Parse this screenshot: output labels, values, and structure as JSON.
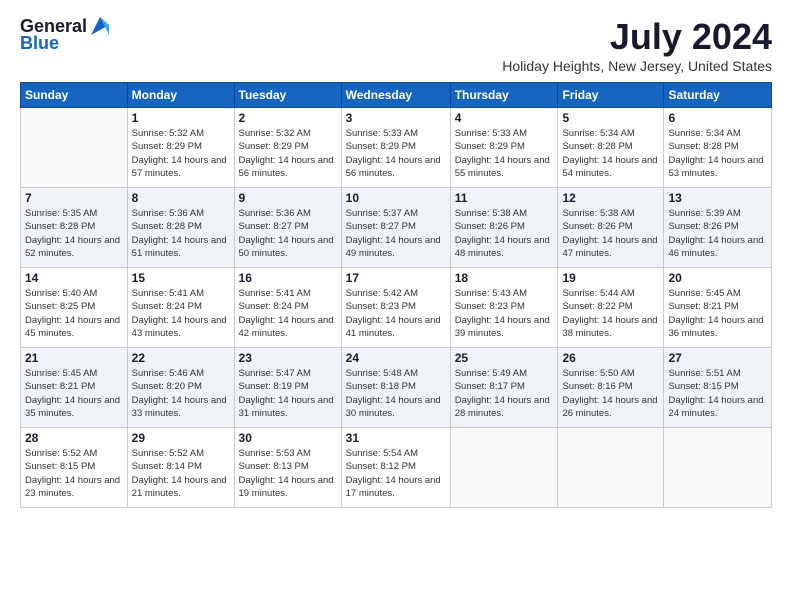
{
  "header": {
    "logo_line1": "General",
    "logo_line2": "Blue",
    "month": "July 2024",
    "location": "Holiday Heights, New Jersey, United States"
  },
  "days_of_week": [
    "Sunday",
    "Monday",
    "Tuesday",
    "Wednesday",
    "Thursday",
    "Friday",
    "Saturday"
  ],
  "weeks": [
    [
      {
        "day": "",
        "sunrise": "",
        "sunset": "",
        "daylight": ""
      },
      {
        "day": "1",
        "sunrise": "Sunrise: 5:32 AM",
        "sunset": "Sunset: 8:29 PM",
        "daylight": "Daylight: 14 hours and 57 minutes."
      },
      {
        "day": "2",
        "sunrise": "Sunrise: 5:32 AM",
        "sunset": "Sunset: 8:29 PM",
        "daylight": "Daylight: 14 hours and 56 minutes."
      },
      {
        "day": "3",
        "sunrise": "Sunrise: 5:33 AM",
        "sunset": "Sunset: 8:29 PM",
        "daylight": "Daylight: 14 hours and 56 minutes."
      },
      {
        "day": "4",
        "sunrise": "Sunrise: 5:33 AM",
        "sunset": "Sunset: 8:29 PM",
        "daylight": "Daylight: 14 hours and 55 minutes."
      },
      {
        "day": "5",
        "sunrise": "Sunrise: 5:34 AM",
        "sunset": "Sunset: 8:28 PM",
        "daylight": "Daylight: 14 hours and 54 minutes."
      },
      {
        "day": "6",
        "sunrise": "Sunrise: 5:34 AM",
        "sunset": "Sunset: 8:28 PM",
        "daylight": "Daylight: 14 hours and 53 minutes."
      }
    ],
    [
      {
        "day": "7",
        "sunrise": "Sunrise: 5:35 AM",
        "sunset": "Sunset: 8:28 PM",
        "daylight": "Daylight: 14 hours and 52 minutes."
      },
      {
        "day": "8",
        "sunrise": "Sunrise: 5:36 AM",
        "sunset": "Sunset: 8:28 PM",
        "daylight": "Daylight: 14 hours and 51 minutes."
      },
      {
        "day": "9",
        "sunrise": "Sunrise: 5:36 AM",
        "sunset": "Sunset: 8:27 PM",
        "daylight": "Daylight: 14 hours and 50 minutes."
      },
      {
        "day": "10",
        "sunrise": "Sunrise: 5:37 AM",
        "sunset": "Sunset: 8:27 PM",
        "daylight": "Daylight: 14 hours and 49 minutes."
      },
      {
        "day": "11",
        "sunrise": "Sunrise: 5:38 AM",
        "sunset": "Sunset: 8:26 PM",
        "daylight": "Daylight: 14 hours and 48 minutes."
      },
      {
        "day": "12",
        "sunrise": "Sunrise: 5:38 AM",
        "sunset": "Sunset: 8:26 PM",
        "daylight": "Daylight: 14 hours and 47 minutes."
      },
      {
        "day": "13",
        "sunrise": "Sunrise: 5:39 AM",
        "sunset": "Sunset: 8:26 PM",
        "daylight": "Daylight: 14 hours and 46 minutes."
      }
    ],
    [
      {
        "day": "14",
        "sunrise": "Sunrise: 5:40 AM",
        "sunset": "Sunset: 8:25 PM",
        "daylight": "Daylight: 14 hours and 45 minutes."
      },
      {
        "day": "15",
        "sunrise": "Sunrise: 5:41 AM",
        "sunset": "Sunset: 8:24 PM",
        "daylight": "Daylight: 14 hours and 43 minutes."
      },
      {
        "day": "16",
        "sunrise": "Sunrise: 5:41 AM",
        "sunset": "Sunset: 8:24 PM",
        "daylight": "Daylight: 14 hours and 42 minutes."
      },
      {
        "day": "17",
        "sunrise": "Sunrise: 5:42 AM",
        "sunset": "Sunset: 8:23 PM",
        "daylight": "Daylight: 14 hours and 41 minutes."
      },
      {
        "day": "18",
        "sunrise": "Sunrise: 5:43 AM",
        "sunset": "Sunset: 8:23 PM",
        "daylight": "Daylight: 14 hours and 39 minutes."
      },
      {
        "day": "19",
        "sunrise": "Sunrise: 5:44 AM",
        "sunset": "Sunset: 8:22 PM",
        "daylight": "Daylight: 14 hours and 38 minutes."
      },
      {
        "day": "20",
        "sunrise": "Sunrise: 5:45 AM",
        "sunset": "Sunset: 8:21 PM",
        "daylight": "Daylight: 14 hours and 36 minutes."
      }
    ],
    [
      {
        "day": "21",
        "sunrise": "Sunrise: 5:45 AM",
        "sunset": "Sunset: 8:21 PM",
        "daylight": "Daylight: 14 hours and 35 minutes."
      },
      {
        "day": "22",
        "sunrise": "Sunrise: 5:46 AM",
        "sunset": "Sunset: 8:20 PM",
        "daylight": "Daylight: 14 hours and 33 minutes."
      },
      {
        "day": "23",
        "sunrise": "Sunrise: 5:47 AM",
        "sunset": "Sunset: 8:19 PM",
        "daylight": "Daylight: 14 hours and 31 minutes."
      },
      {
        "day": "24",
        "sunrise": "Sunrise: 5:48 AM",
        "sunset": "Sunset: 8:18 PM",
        "daylight": "Daylight: 14 hours and 30 minutes."
      },
      {
        "day": "25",
        "sunrise": "Sunrise: 5:49 AM",
        "sunset": "Sunset: 8:17 PM",
        "daylight": "Daylight: 14 hours and 28 minutes."
      },
      {
        "day": "26",
        "sunrise": "Sunrise: 5:50 AM",
        "sunset": "Sunset: 8:16 PM",
        "daylight": "Daylight: 14 hours and 26 minutes."
      },
      {
        "day": "27",
        "sunrise": "Sunrise: 5:51 AM",
        "sunset": "Sunset: 8:15 PM",
        "daylight": "Daylight: 14 hours and 24 minutes."
      }
    ],
    [
      {
        "day": "28",
        "sunrise": "Sunrise: 5:52 AM",
        "sunset": "Sunset: 8:15 PM",
        "daylight": "Daylight: 14 hours and 23 minutes."
      },
      {
        "day": "29",
        "sunrise": "Sunrise: 5:52 AM",
        "sunset": "Sunset: 8:14 PM",
        "daylight": "Daylight: 14 hours and 21 minutes."
      },
      {
        "day": "30",
        "sunrise": "Sunrise: 5:53 AM",
        "sunset": "Sunset: 8:13 PM",
        "daylight": "Daylight: 14 hours and 19 minutes."
      },
      {
        "day": "31",
        "sunrise": "Sunrise: 5:54 AM",
        "sunset": "Sunset: 8:12 PM",
        "daylight": "Daylight: 14 hours and 17 minutes."
      },
      {
        "day": "",
        "sunrise": "",
        "sunset": "",
        "daylight": ""
      },
      {
        "day": "",
        "sunrise": "",
        "sunset": "",
        "daylight": ""
      },
      {
        "day": "",
        "sunrise": "",
        "sunset": "",
        "daylight": ""
      }
    ]
  ]
}
